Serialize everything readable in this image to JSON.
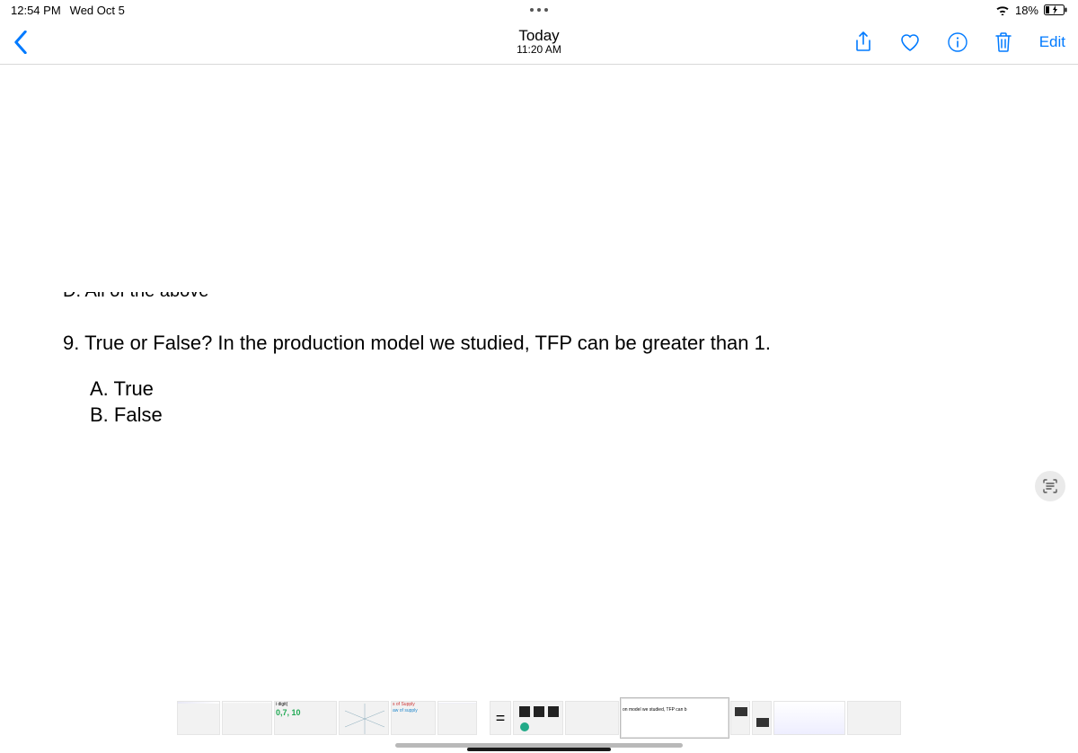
{
  "status": {
    "time": "12:54 PM",
    "date": "Wed Oct 5",
    "battery_pct": "18%"
  },
  "nav": {
    "title": "Today",
    "subtitle": "11:20 AM",
    "edit_label": "Edit"
  },
  "doc": {
    "prev_option": "D. All of the above",
    "question": "9. True or False?  In the production model we studied, TFP can be greater than 1.",
    "option_a": "A. True",
    "option_b": "B. False"
  },
  "thumbs": {
    "t3_a": "i digit(",
    "t3_b": "0,7,  10",
    "t4_a": "s of Supply",
    "t8_a": "on model we studied, TFP can b"
  }
}
